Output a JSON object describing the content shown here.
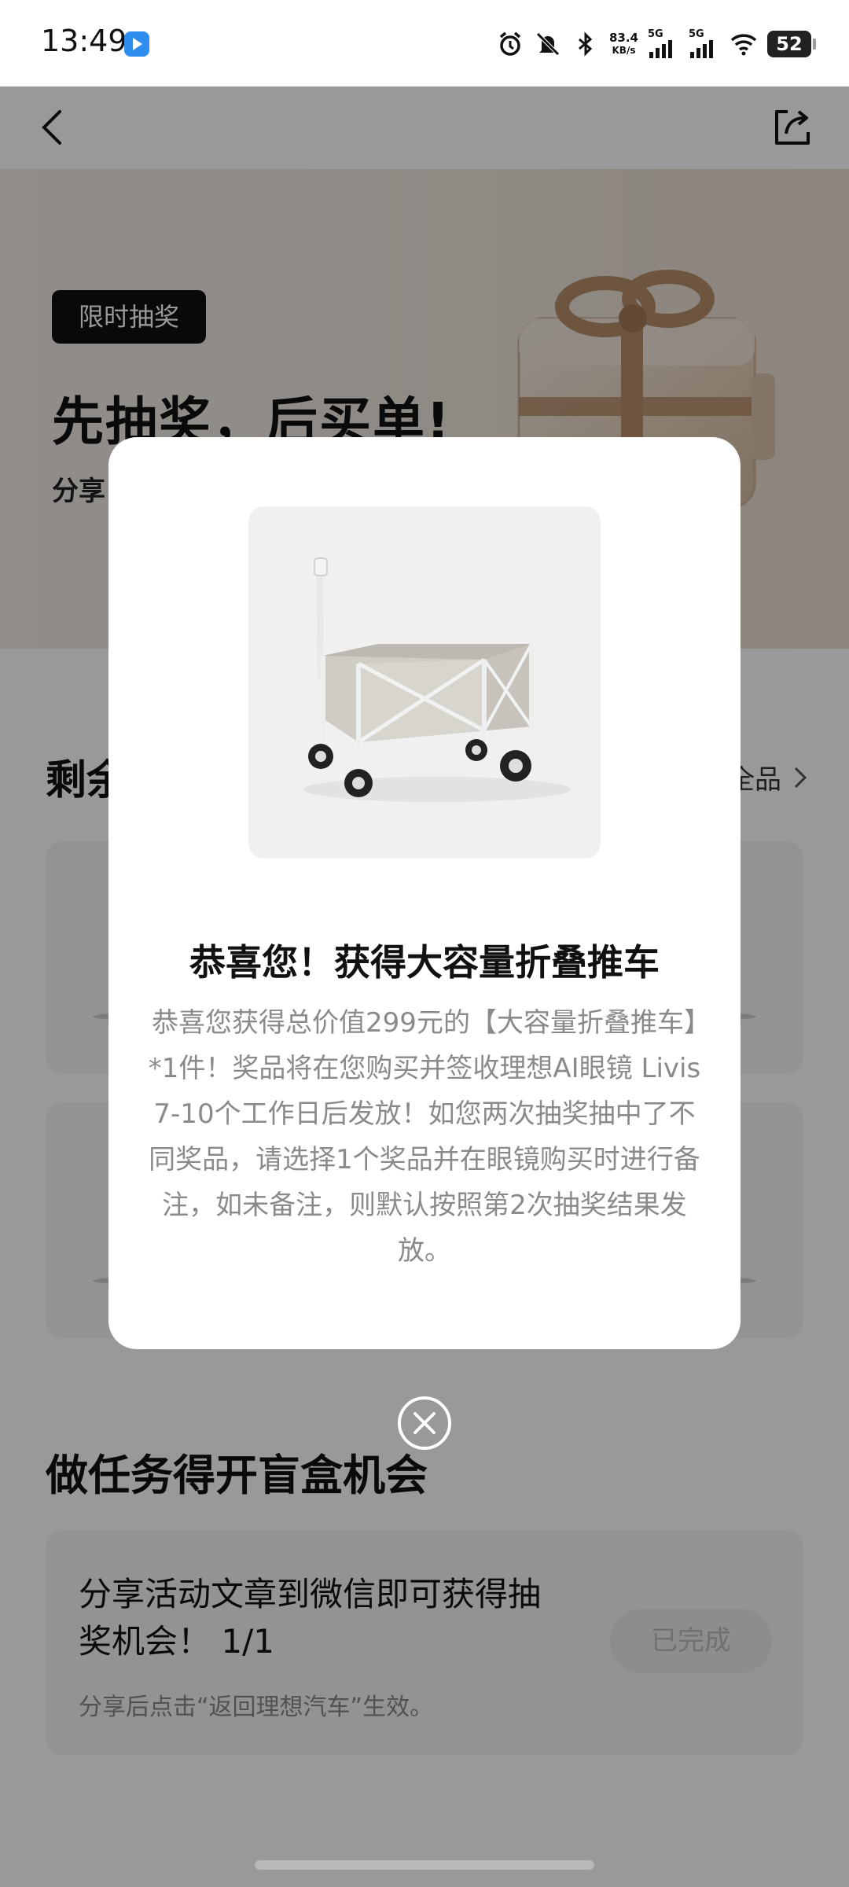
{
  "status_bar": {
    "time": "13:49",
    "net_speed_value": "83.4",
    "net_speed_unit": "KB/s",
    "signal1_label": "5G",
    "signal2_label": "5G",
    "battery": "52",
    "icons": [
      "alarm-icon",
      "mute-bell-icon",
      "bluetooth-icon",
      "signal-icon",
      "signal-icon",
      "wifi-icon",
      "battery-icon"
    ]
  },
  "nav": {
    "title": "",
    "back_icon": "chevron-left-icon",
    "share_icon": "share-icon"
  },
  "hero": {
    "badge": "限时抽奖",
    "title": "先抽奖，后买单!",
    "subtitle": "分享"
  },
  "prizes": {
    "title": "剩余",
    "link_text": "全品"
  },
  "task": {
    "section_title": "做任务得开盲盒机会",
    "text": "分享活动文章到微信即可获得抽奖机会！ 1/1",
    "hint": "分享后点击“返回理想汽车”生效。",
    "button": "已完成"
  },
  "modal": {
    "title": "恭喜您！获得大容量折叠推车",
    "body": "恭喜您获得总价值299元的【大容量折叠推车】*1件！奖品将在您购买并签收理想AI眼镜 Livis 7-10个工作日后发放！如您两次抽奖抽中了不同奖品，请选择1个奖品并在眼镜购买时进行备注，如未备注，则默认按照第2次抽奖结果发放。"
  },
  "colors": {
    "overlay": "#000000",
    "badge_bg": "#0f0f0f",
    "hero_bg": "#efe6dd",
    "done_button_bg": "#ececec"
  }
}
